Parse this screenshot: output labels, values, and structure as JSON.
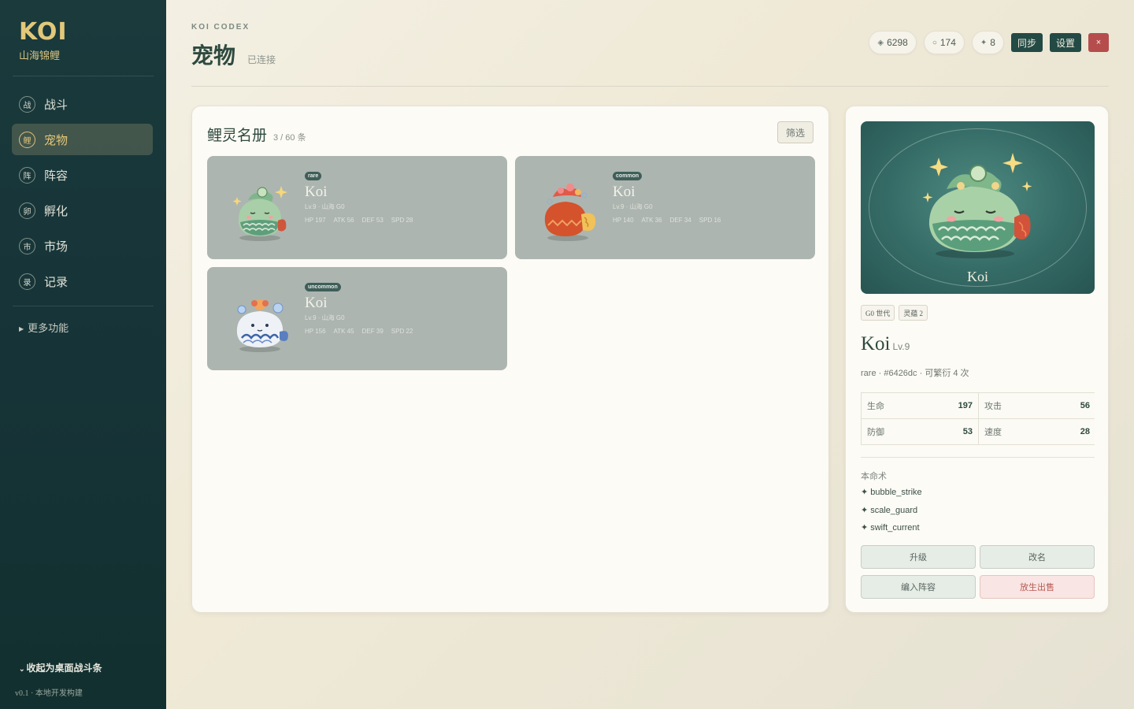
{
  "sidebar": {
    "brand": "KOI",
    "brand_sub": "山海锦鲤",
    "nav": [
      {
        "glyph": "战",
        "label": "战斗"
      },
      {
        "glyph": "鲤",
        "label": "宠物"
      },
      {
        "glyph": "阵",
        "label": "阵容"
      },
      {
        "glyph": "卵",
        "label": "孵化"
      },
      {
        "glyph": "市",
        "label": "市场"
      },
      {
        "glyph": "录",
        "label": "记录"
      }
    ],
    "more": "更多功能",
    "collapse": "收起为桌面战斗条",
    "version": "v0.1 · 本地开发构建"
  },
  "header": {
    "eyebrow": "KOI CODEX",
    "title": "宠物",
    "status": "已连接",
    "stats": [
      {
        "glyph": "◈",
        "value": "6298"
      },
      {
        "glyph": "○",
        "value": "174"
      },
      {
        "glyph": "✦",
        "value": "8"
      }
    ],
    "sync_label": "同步",
    "settings_label": "设置",
    "close_label": "×"
  },
  "roster": {
    "title": "鲤灵名册",
    "count": "3 / 60 条",
    "filter_label": "筛选",
    "pets": [
      {
        "rarity": "rare",
        "name": "Koi",
        "meta": "Lv.9 · 山海 G0",
        "stats": [
          "HP 197",
          "ATK 56",
          "DEF 53",
          "SPD 28"
        ]
      },
      {
        "rarity": "common",
        "name": "Koi",
        "meta": "Lv.9 · 山海 G0",
        "stats": [
          "HP 140",
          "ATK 36",
          "DEF 34",
          "SPD 16"
        ]
      },
      {
        "rarity": "uncommon",
        "name": "Koi",
        "meta": "Lv.9 · 山海 G0",
        "stats": [
          "HP 156",
          "ATK 45",
          "DEF 39",
          "SPD 22"
        ]
      }
    ]
  },
  "detail": {
    "portrait_name": "Koi",
    "tags": [
      "G0 世代",
      "灵蕴 2"
    ],
    "name": "Koi",
    "level": "Lv.9",
    "subline": "rare · #6426dc · 可繁衍 4 次",
    "stats": [
      {
        "label": "生命",
        "value": "197"
      },
      {
        "label": "攻击",
        "value": "56"
      },
      {
        "label": "防御",
        "value": "53"
      },
      {
        "label": "速度",
        "value": "28"
      }
    ],
    "skills_label": "本命术",
    "skills": [
      "bubble_strike",
      "scale_guard",
      "swift_current"
    ],
    "actions": {
      "upgrade": "升级",
      "rename": "改名",
      "add_team": "编入阵容",
      "release": "放生出售"
    }
  },
  "colors": {
    "sidebar_bg": "#163337",
    "gold": "#e2c87a",
    "primary_dark": "#234a45",
    "danger": "#b64d4d",
    "card_tile": "#adb5b0"
  },
  "icons": {
    "pet_art": [
      "koi-green-fish-icon",
      "koi-red-fish-icon",
      "koi-blue-fish-icon"
    ],
    "skill_bullet": "sparkle-icon"
  }
}
